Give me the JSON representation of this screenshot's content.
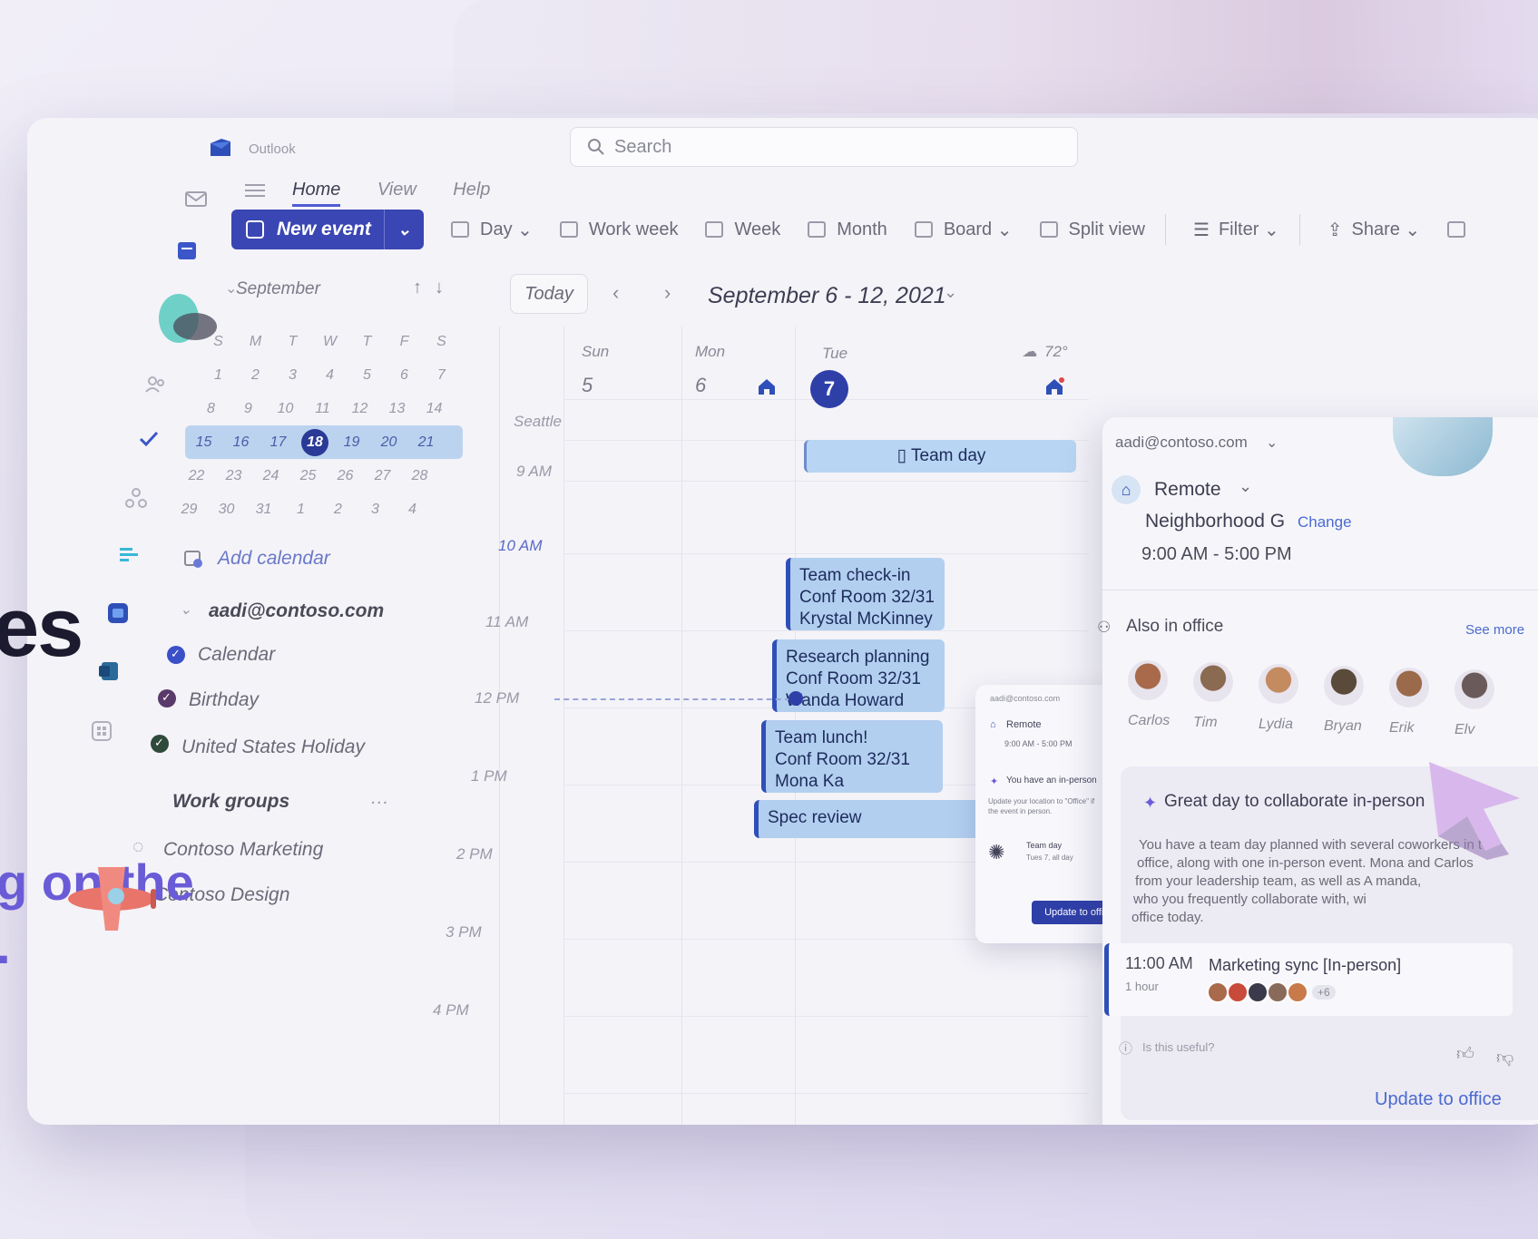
{
  "hero": {
    "line1": "es",
    "line2": "g on the",
    "line3": "."
  },
  "app": {
    "name": "Outlook",
    "search_placeholder": "Search"
  },
  "ribbon": {
    "tabs": [
      {
        "label": "Home"
      },
      {
        "label": "View"
      },
      {
        "label": "Help"
      }
    ],
    "new_event_label": "New event",
    "toolbar": [
      {
        "label": "Day",
        "icon": "day-view-icon",
        "dropdown": true
      },
      {
        "label": "Work week",
        "icon": "work-week-icon"
      },
      {
        "label": "Week",
        "icon": "week-icon"
      },
      {
        "label": "Month",
        "icon": "month-icon"
      },
      {
        "label": "Board",
        "icon": "board-icon",
        "dropdown": true
      },
      {
        "label": "Split view",
        "icon": "split-view-icon"
      },
      {
        "label": "Filter",
        "icon": "filter-icon",
        "dropdown": true
      },
      {
        "label": "Share",
        "icon": "share-icon",
        "dropdown": true
      }
    ]
  },
  "mini_calendar": {
    "month": "September",
    "weekday_headers": [
      "S",
      "M",
      "T",
      "W",
      "T",
      "F",
      "S"
    ],
    "weeks": [
      [
        "1",
        "2",
        "3",
        "4",
        "5",
        "6",
        "7"
      ],
      [
        "8",
        "9",
        "10",
        "11",
        "12",
        "13",
        "14"
      ],
      [
        "15",
        "16",
        "17",
        "18",
        "19",
        "20",
        "21"
      ],
      [
        "22",
        "23",
        "24",
        "25",
        "26",
        "27",
        "28"
      ],
      [
        "29",
        "30",
        "31",
        "1",
        "2",
        "3",
        "4"
      ]
    ],
    "selected_day": "18"
  },
  "sidebar": {
    "add_calendar": "Add calendar",
    "account": "aadi@contoso.com",
    "calendars": [
      {
        "label": "Calendar",
        "color": "#3a50c8"
      },
      {
        "label": "Birthday",
        "color": "#5a3a6a"
      },
      {
        "label": "United States Holiday",
        "color": "#2e4a3a"
      }
    ],
    "work_groups_label": "Work groups",
    "work_groups": [
      {
        "label": "Contoso Marketing"
      },
      {
        "label": "Contoso Design"
      }
    ]
  },
  "calendar": {
    "today_label": "Today",
    "date_range": "September 6 - 12, 2021",
    "location": "Seattle",
    "weather": "72°",
    "days": [
      {
        "name": "Sun",
        "num": "5"
      },
      {
        "name": "Mon",
        "num": "6"
      },
      {
        "name": "Tue",
        "num": "7"
      }
    ],
    "times": [
      "9 AM",
      "10 AM",
      "11 AM",
      "12 PM",
      "1 PM",
      "2 PM",
      "3 PM",
      "4 PM"
    ],
    "all_day_event": "Team day",
    "events": [
      {
        "title": "Team check-in",
        "room": "Conf Room 32/31",
        "person": "Krystal McKinney"
      },
      {
        "title": "Research planning",
        "room": "Conf Room 32/31",
        "person": "Wanda Howard"
      },
      {
        "title": "Team lunch!",
        "room": "Conf Room 32/31",
        "person": "Mona Ka"
      },
      {
        "title": "Spec review",
        "room": "",
        "person": ""
      }
    ]
  },
  "popup": {
    "email": "aadi@contoso.com",
    "status": "Remote",
    "hours": "9:00 AM - 5:00 PM",
    "notice_title": "You have an in-person",
    "notice_body1": "Update your location to \"Office\" if",
    "notice_body2": "the event in person.",
    "event_title": "Team day",
    "event_sub": "Tues 7, all day",
    "button": "Update to office"
  },
  "panel": {
    "email": "aadi@contoso.com",
    "status": "Remote",
    "neighborhood": "Neighborhood G",
    "change_label": "Change",
    "hours": "9:00 AM - 5:00 PM",
    "also_in_office": "Also in office",
    "see_more": "See more",
    "people": [
      {
        "name": "Carlos",
        "color": "#a86a4a"
      },
      {
        "name": "Tim",
        "color": "#8a6a50"
      },
      {
        "name": "Lydia",
        "color": "#c48a60"
      },
      {
        "name": "Bryan",
        "color": "#5a4a3a"
      },
      {
        "name": "Erik",
        "color": "#9a6a4a"
      },
      {
        "name": "Elv",
        "color": "#6a5a5a"
      }
    ],
    "collab_title": "Great day to collaborate in-person",
    "collab_body": [
      "You have a team day planned with several coworkers in t",
      "office, along with one in-person event. Mona and Carlos",
      "from your leadership team, as well as A           manda,",
      "who you frequently collaborate with, wi",
      "office today."
    ],
    "meeting_time": "11:00 AM",
    "meeting_duration": "1 hour",
    "meeting_title": "Marketing sync [In-person]",
    "meeting_extra": "+6",
    "useful_label": "Is this useful?",
    "update_label": "Update to office"
  }
}
